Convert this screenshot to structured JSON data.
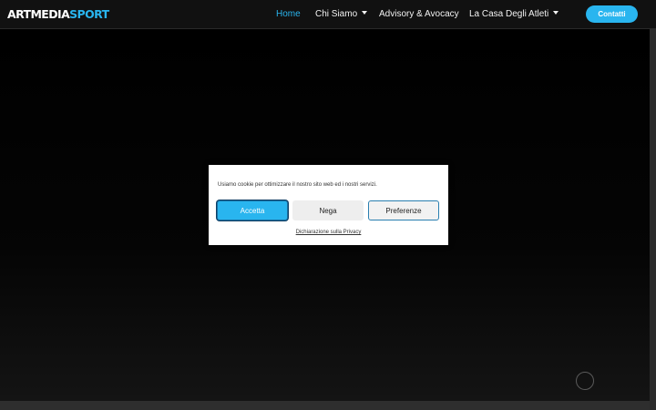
{
  "header": {
    "logo": {
      "main": "ARTMEDIA",
      "accent": "SPORT"
    },
    "nav": [
      {
        "label": "Home",
        "active": true,
        "has_dropdown": false
      },
      {
        "label": "Chi Siamo",
        "active": false,
        "has_dropdown": true
      },
      {
        "label": "Advisory & Avocacy",
        "active": false,
        "has_dropdown": false
      },
      {
        "label": "La Casa Degli Atleti",
        "active": false,
        "has_dropdown": true
      }
    ],
    "cta_label": "Contatti"
  },
  "cookie_banner": {
    "message": "Usiamo cookie per ottimizzare il nostro sito web ed i nostri servizi.",
    "accept_label": "Accetta",
    "deny_label": "Nega",
    "preferences_label": "Preferenze",
    "privacy_link": "Dichiarazione sulla Privacy"
  },
  "colors": {
    "accent": "#29b5ef",
    "header_bg": "#111111",
    "hero_bg": "#000000",
    "modal_bg": "#ffffff"
  },
  "icons": {
    "dropdown": "caret-down-icon",
    "loader": "loading-spinner-icon"
  }
}
